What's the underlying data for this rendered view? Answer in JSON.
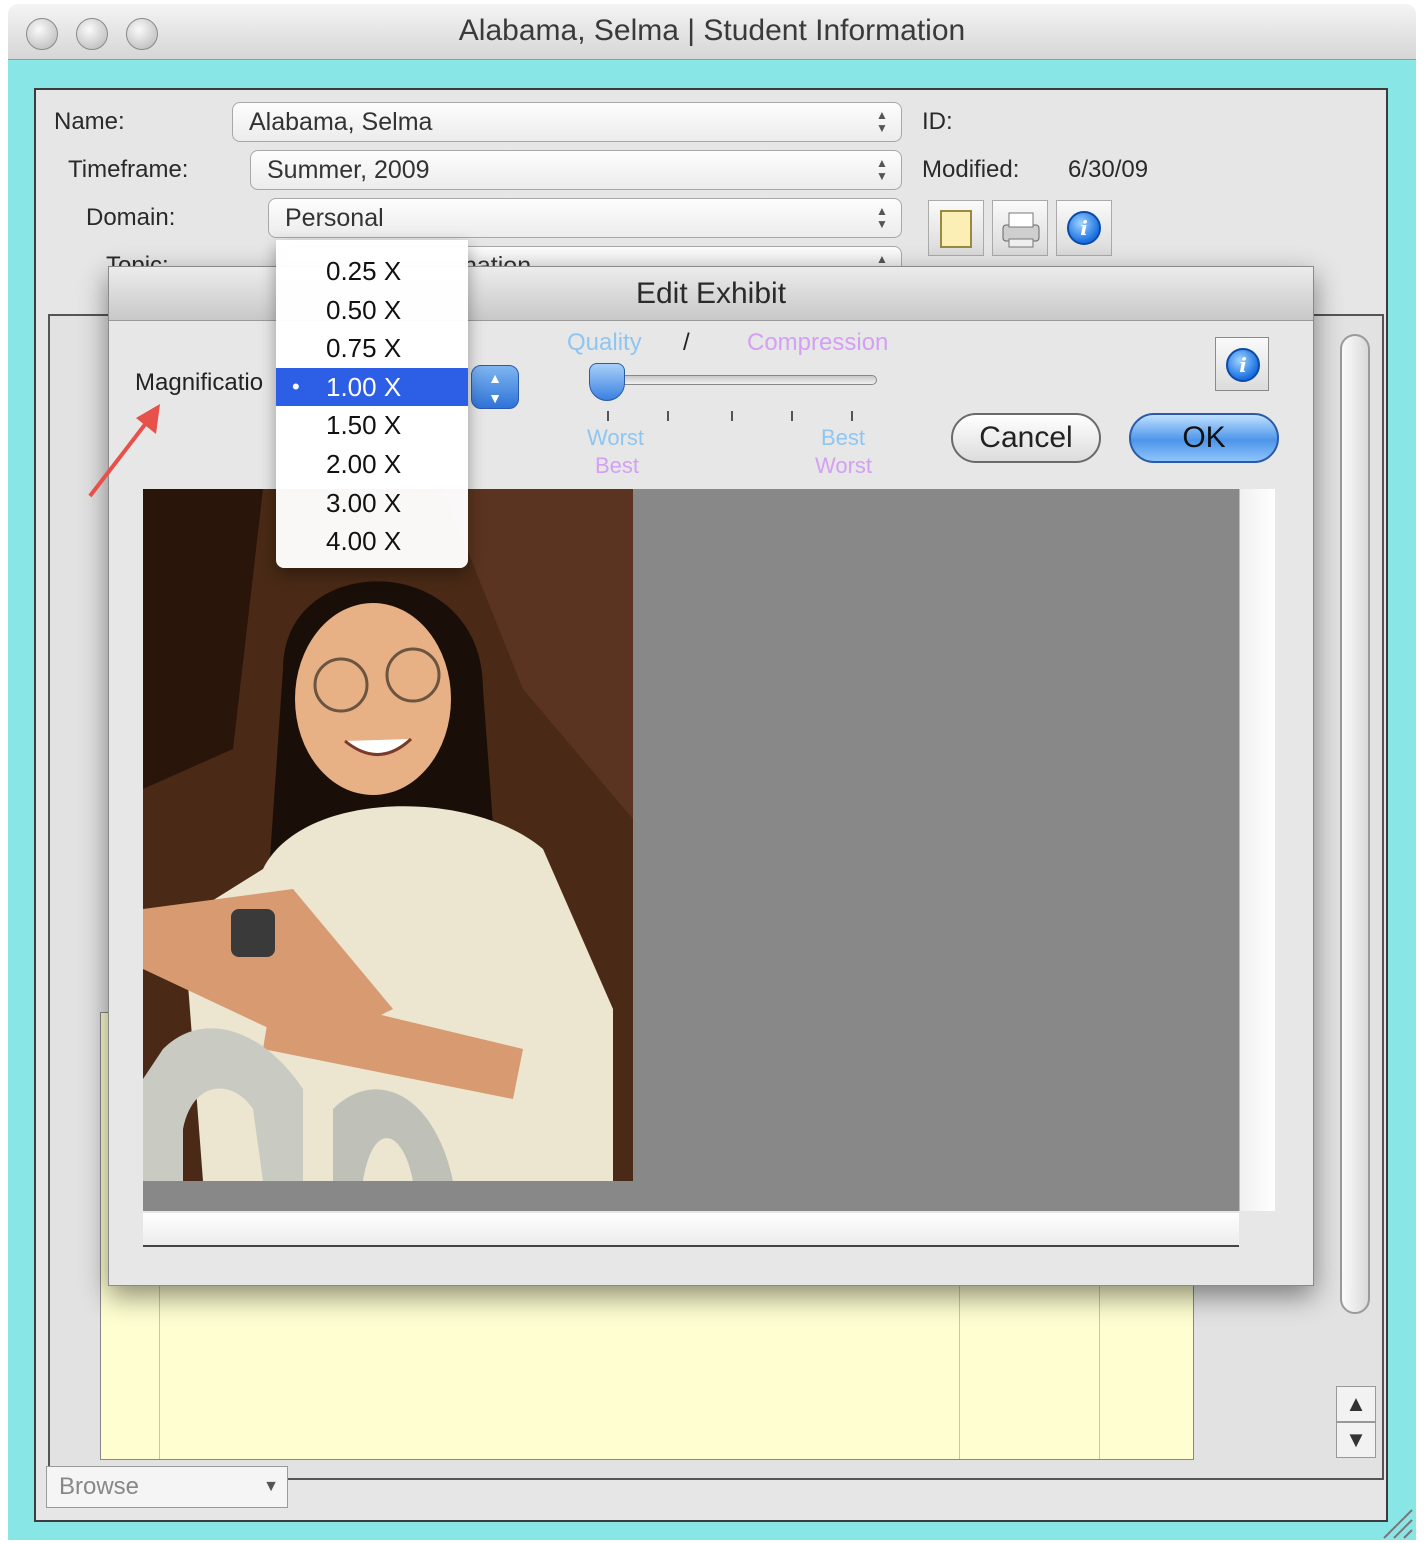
{
  "window": {
    "title": "Alabama, Selma | Student Information"
  },
  "record": {
    "name_label": "Name:",
    "name_value": "Alabama, Selma",
    "timeframe_label": "Timeframe:",
    "timeframe_value": "Summer, 2009",
    "domain_label": "Domain:",
    "domain_value": "Personal",
    "topic_label": "Topic:",
    "topic_value_visible": "nation",
    "id_label": "ID:",
    "modified_label": "Modified:",
    "modified_value": "6/30/09"
  },
  "toolbar": {
    "icons": [
      "note-icon",
      "printer-icon",
      "info-icon"
    ]
  },
  "dialog": {
    "title": "Edit Exhibit",
    "magnification_label": "Magnificatio",
    "quality_label": "Quality",
    "slash": "/",
    "compression_label": "Compression",
    "left_top": "Worst",
    "left_bottom": "Best",
    "right_top": "Best",
    "right_bottom": "Worst",
    "cancel_label": "Cancel",
    "ok_label": "OK",
    "slider_value": 0.0
  },
  "magnification_menu": {
    "options": [
      "0.25 X",
      "0.50 X",
      "0.75 X",
      "1.00 X",
      "1.50 X",
      "2.00 X",
      "3.00 X",
      "4.00 X"
    ],
    "selected": "1.00 X"
  },
  "footer": {
    "mode": "Browse"
  },
  "colors": {
    "frame": "#89e6e6",
    "quality": "#8ec6f2",
    "compression": "#d3a0f2",
    "menu_highlight": "#2c5ee6",
    "table_fill": "#fefed0",
    "preview_bg": "#888888"
  }
}
